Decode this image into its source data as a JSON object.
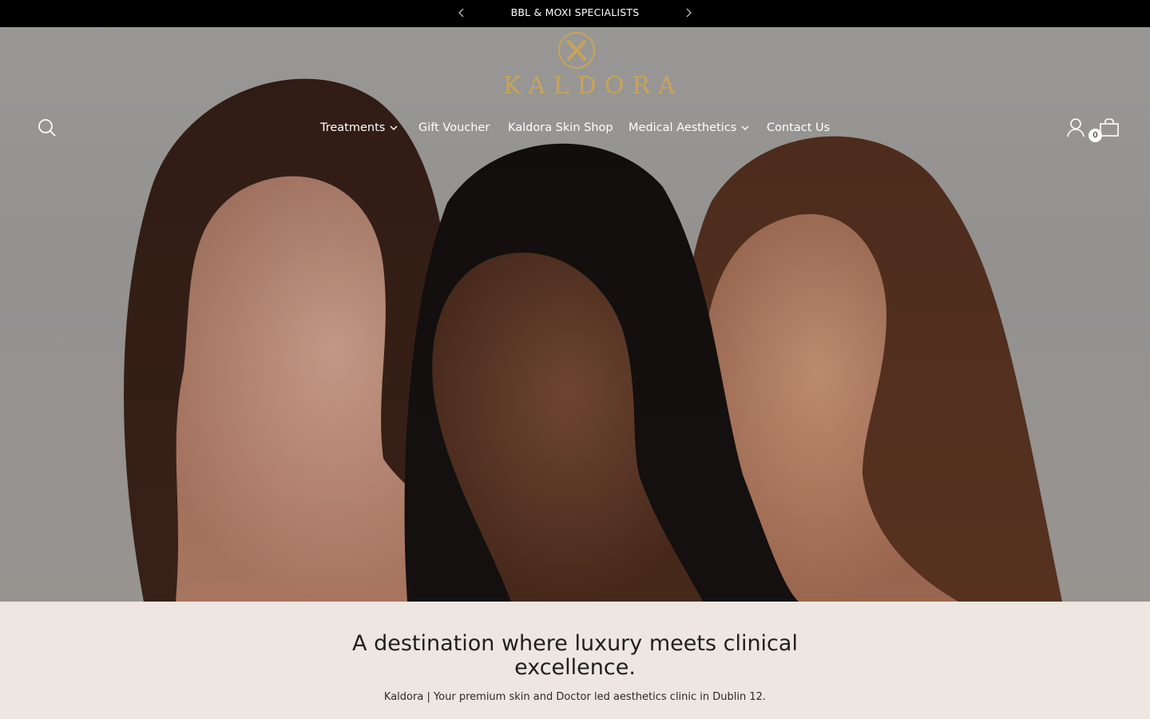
{
  "announcement": {
    "text": "BBL & MOXI SPECIALISTS"
  },
  "brand": {
    "name": "KALDORA",
    "accent": "#c9a35a"
  },
  "nav": {
    "items": [
      {
        "label": "Treatments",
        "dropdown": true
      },
      {
        "label": "Gift Voucher",
        "dropdown": false
      },
      {
        "label": "Kaldora Skin Shop",
        "dropdown": false
      },
      {
        "label": "Medical Aesthetics",
        "dropdown": true
      },
      {
        "label": "Contact Us",
        "dropdown": false
      }
    ]
  },
  "header_icons": {
    "search": "search-icon",
    "account": "user-icon",
    "cart": "shopping-bag-icon"
  },
  "cart": {
    "count": "0"
  },
  "intro": {
    "heading": "A destination where luxury meets clinical excellence.",
    "subtext": "Kaldora | Your premium skin and Doctor led aesthetics clinic in Dublin 12."
  }
}
